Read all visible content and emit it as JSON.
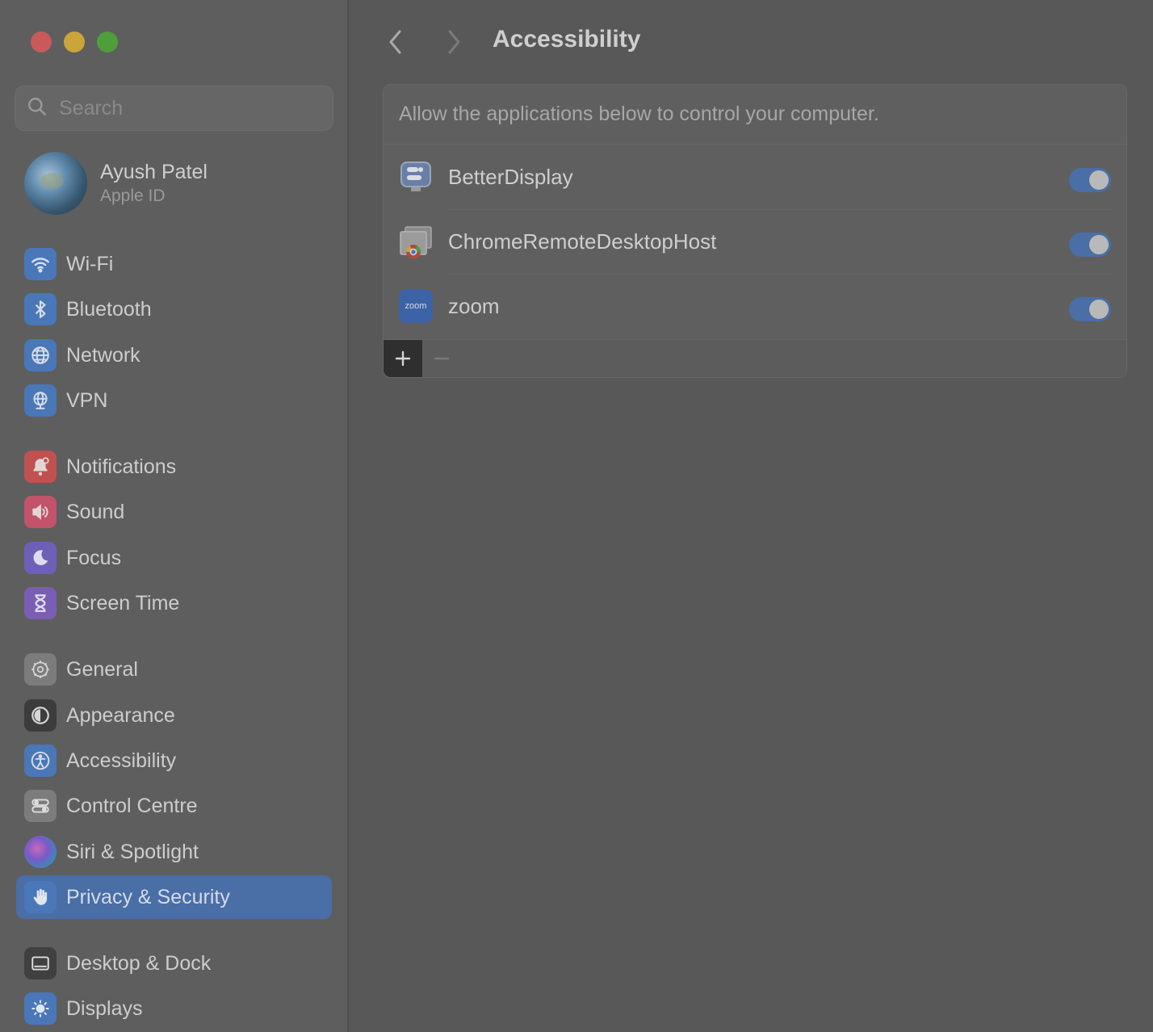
{
  "window": {
    "traffic_lights": [
      "close",
      "minimize",
      "maximize"
    ]
  },
  "search": {
    "placeholder": "Search",
    "value": ""
  },
  "profile": {
    "name": "Ayush Patel",
    "subtitle": "Apple ID"
  },
  "sidebar": {
    "items": [
      {
        "label": "Wi-Fi",
        "icon": "wifi-icon"
      },
      {
        "label": "Bluetooth",
        "icon": "bluetooth-icon"
      },
      {
        "label": "Network",
        "icon": "globe-icon"
      },
      {
        "label": "VPN",
        "icon": "vpn-globe-icon"
      },
      {
        "label": "Notifications",
        "icon": "bell-icon"
      },
      {
        "label": "Sound",
        "icon": "speaker-icon"
      },
      {
        "label": "Focus",
        "icon": "moon-icon"
      },
      {
        "label": "Screen Time",
        "icon": "hourglass-icon"
      },
      {
        "label": "General",
        "icon": "gear-icon"
      },
      {
        "label": "Appearance",
        "icon": "appearance-icon"
      },
      {
        "label": "Accessibility",
        "icon": "accessibility-icon"
      },
      {
        "label": "Control Centre",
        "icon": "switches-icon"
      },
      {
        "label": "Siri & Spotlight",
        "icon": "siri-icon"
      },
      {
        "label": "Privacy & Security",
        "icon": "hand-icon",
        "selected": true
      },
      {
        "label": "Desktop & Dock",
        "icon": "dock-icon"
      },
      {
        "label": "Displays",
        "icon": "sun-icon"
      }
    ]
  },
  "main": {
    "title": "Accessibility",
    "description": "Allow the applications below to control your computer.",
    "apps": [
      {
        "name": "BetterDisplay",
        "enabled": true
      },
      {
        "name": "ChromeRemoteDesktopHost",
        "enabled": true
      },
      {
        "name": "zoom",
        "enabled": true
      }
    ],
    "zoom_icon_text": "zoom",
    "add_label": "+",
    "remove_label": "−"
  },
  "colors": {
    "accent": "#4a6ea6",
    "background": "#585858",
    "sidebar": "#5e5e5e"
  }
}
